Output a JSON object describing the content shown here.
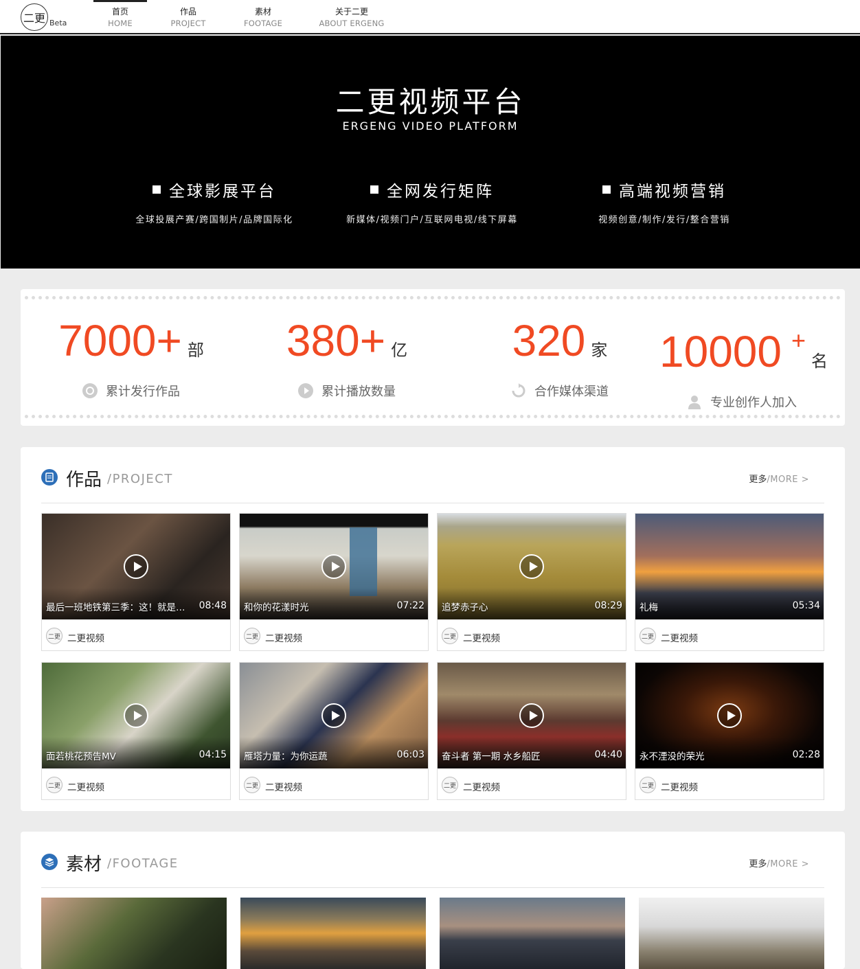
{
  "nav": {
    "logo_text": "二更",
    "beta": "Beta",
    "items": [
      {
        "zh": "首页",
        "en": "HOME"
      },
      {
        "zh": "作品",
        "en": "PROJECT"
      },
      {
        "zh": "素材",
        "en": "FOOTAGE"
      },
      {
        "zh": "关于二更",
        "en": "ABOUT ERGENG"
      }
    ]
  },
  "hero": {
    "title": "二更视频平台",
    "subtitle": "ERGENG VIDEO PLATFORM",
    "features": [
      {
        "title": "全球影展平台",
        "desc": "全球投展产赛/跨国制片/品牌国际化"
      },
      {
        "title": "全网发行矩阵",
        "desc": "新媒体/视频门户/互联网电视/线下屏幕"
      },
      {
        "title": "高端视频营销",
        "desc": "视频创意/制作/发行/整合营销"
      }
    ]
  },
  "stats": [
    {
      "number": "7000+",
      "unit": "部",
      "label": "累计发行作品",
      "icon": "target-icon"
    },
    {
      "number": "380+",
      "unit": "亿",
      "label": "累计播放数量",
      "icon": "play-circle-icon"
    },
    {
      "number": "320",
      "unit": "家",
      "label": "合作媒体渠道",
      "icon": "sync-icon"
    },
    {
      "number": "10000",
      "plus": "+",
      "unit": "名",
      "label": "专业创作人加入",
      "icon": "user-icon"
    }
  ],
  "projects": {
    "title": "作品",
    "title_en": "/PROJECT",
    "more_zh": "更多",
    "more_en": "/MORE >",
    "videos": [
      {
        "title": "最后一班地铁第三季：这！就是街舞",
        "duration": "08:48",
        "author": "二更视频"
      },
      {
        "title": "和你的花漾时光",
        "duration": "07:22",
        "author": "二更视频"
      },
      {
        "title": "追梦赤子心",
        "duration": "08:29",
        "author": "二更视频"
      },
      {
        "title": "礼梅",
        "duration": "05:34",
        "author": "二更视频"
      },
      {
        "title": "面若桃花预告MV",
        "duration": "04:15",
        "author": "二更视频"
      },
      {
        "title": "雁塔力量：为你运蔬",
        "duration": "06:03",
        "author": "二更视频"
      },
      {
        "title": "奋斗者 第一期 水乡船匠",
        "duration": "04:40",
        "author": "二更视频"
      },
      {
        "title": "永不湮没的荣光",
        "duration": "02:28",
        "author": "二更视频"
      }
    ]
  },
  "footage": {
    "title": "素材",
    "title_en": "/FOOTAGE",
    "more_zh": "更多",
    "more_en": "/MORE >"
  },
  "colors": {
    "accent": "#f04a23",
    "icon_blue": "#2d6fb8"
  }
}
